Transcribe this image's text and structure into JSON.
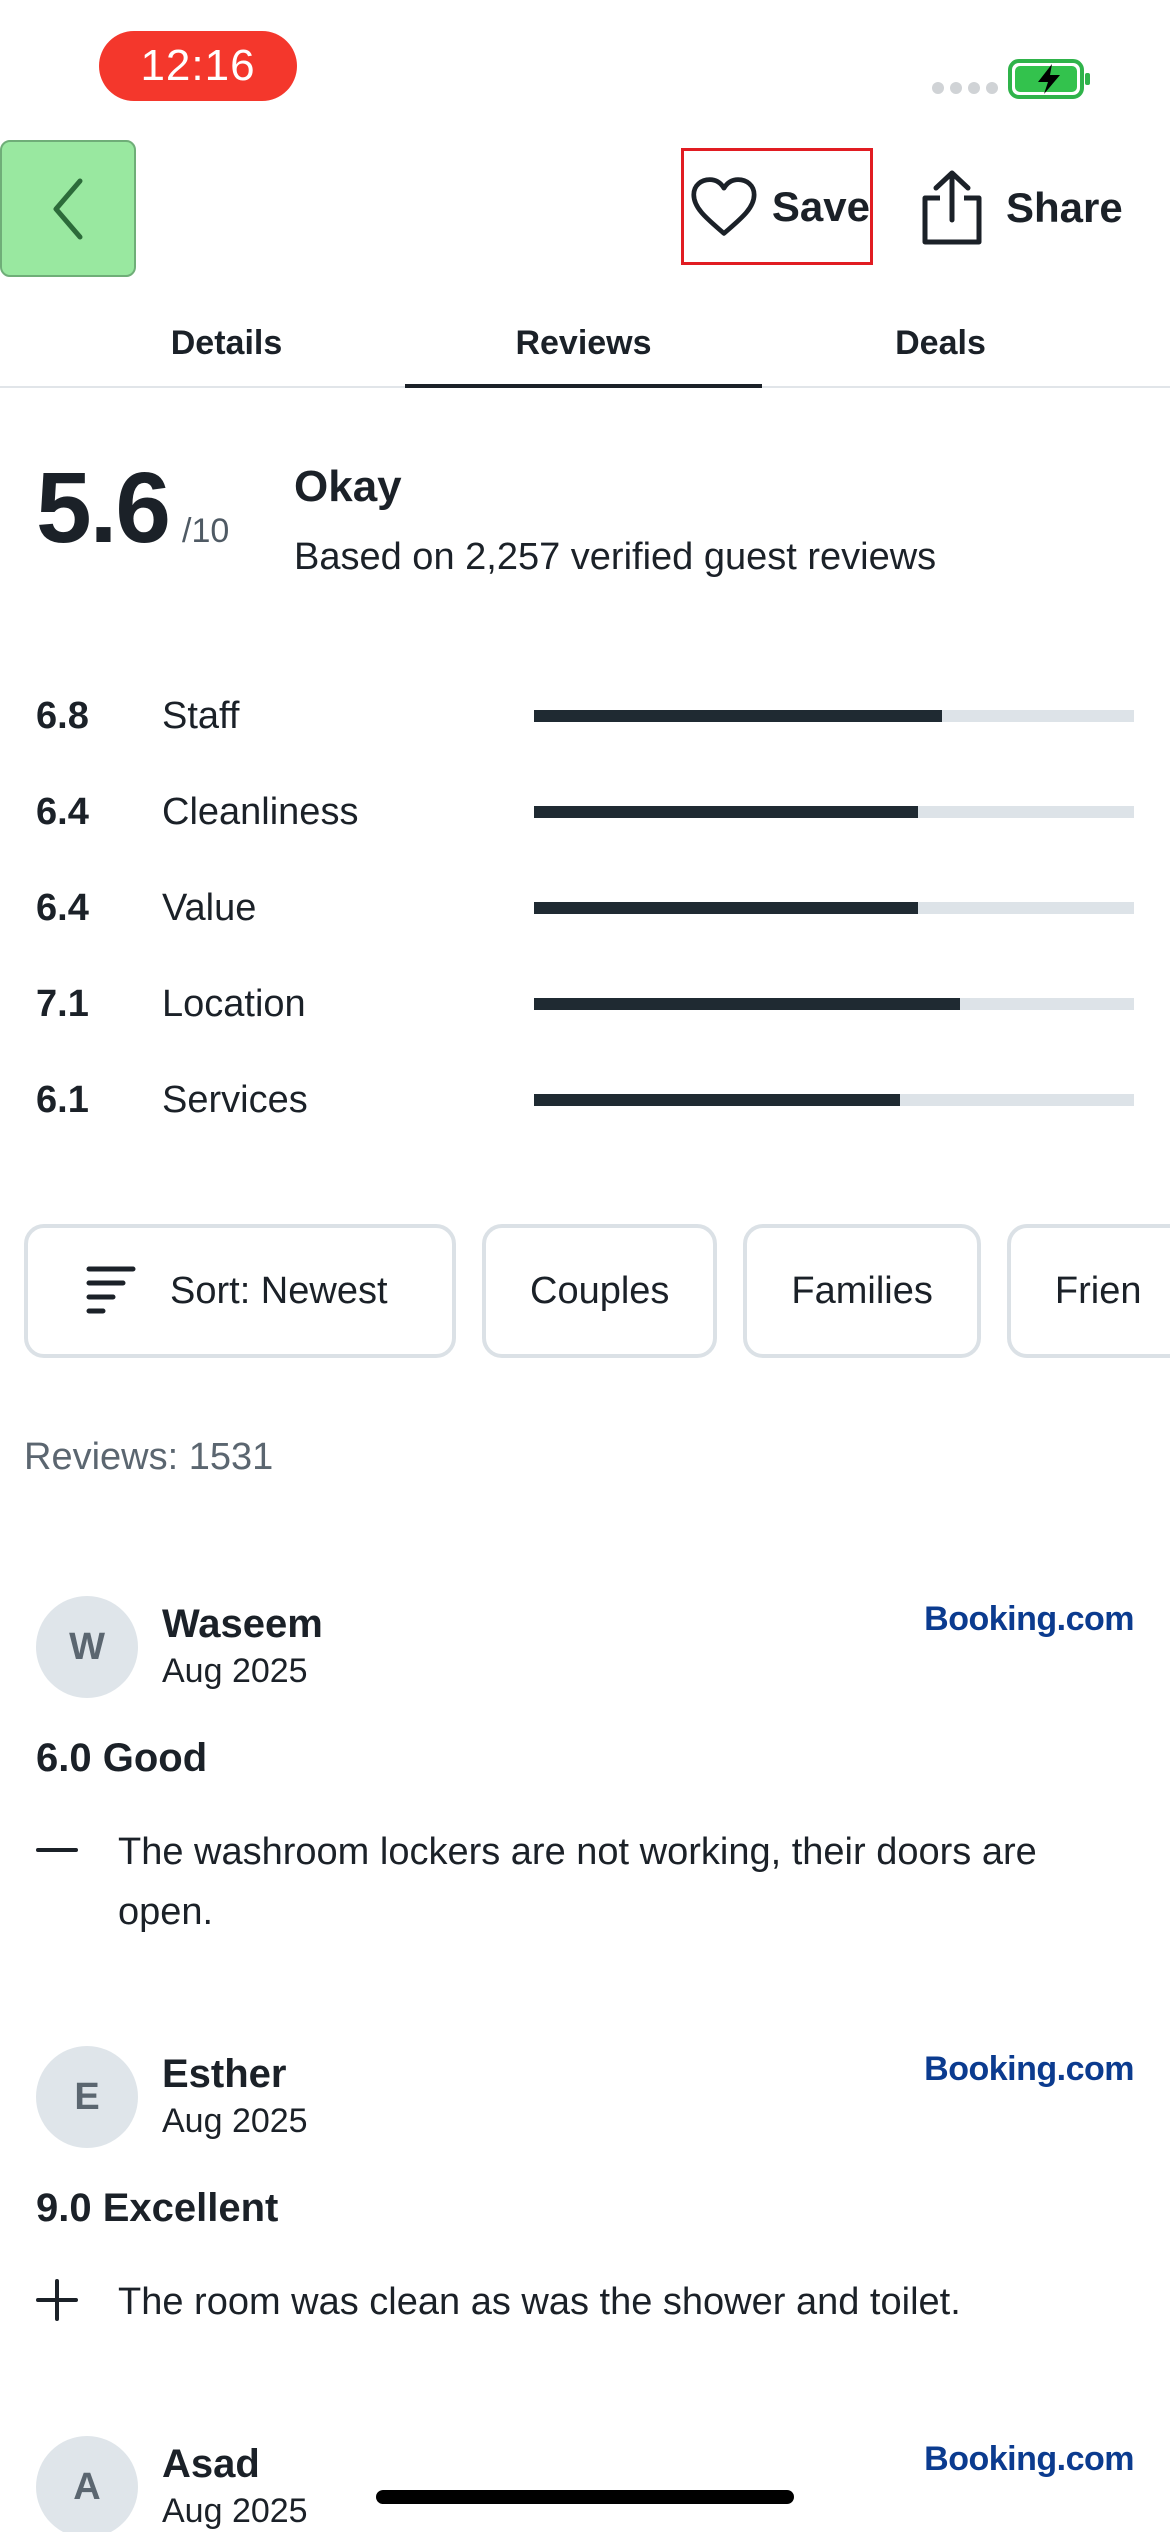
{
  "status_bar": {
    "time": "12:16"
  },
  "header": {
    "back_icon": "chevron-left-icon",
    "save_label": "Save",
    "share_label": "Share"
  },
  "tabs": [
    {
      "label": "Details",
      "active": false
    },
    {
      "label": "Reviews",
      "active": true
    },
    {
      "label": "Deals",
      "active": false
    }
  ],
  "overall": {
    "score": "5.6",
    "out_of": "/10",
    "word": "Okay",
    "basis": "Based on 2,257 verified guest reviews"
  },
  "ratings": [
    {
      "value": "6.8",
      "label": "Staff",
      "fraction": 0.68
    },
    {
      "value": "6.4",
      "label": "Cleanliness",
      "fraction": 0.64
    },
    {
      "value": "6.4",
      "label": "Value",
      "fraction": 0.64
    },
    {
      "value": "7.1",
      "label": "Location",
      "fraction": 0.71
    },
    {
      "value": "6.1",
      "label": "Services",
      "fraction": 0.61
    }
  ],
  "filters": {
    "sort_label": "Sort: Newest",
    "chips": [
      "Couples",
      "Families",
      "Frien"
    ]
  },
  "reviews_count": "Reviews: 1531",
  "reviews": [
    {
      "initial": "W",
      "name": "Waseem",
      "date": "Aug 2025",
      "source": "Booking.com",
      "score": "6.0 Good",
      "sign": "minus",
      "text": "The washroom lockers are not working, their doors are open."
    },
    {
      "initial": "E",
      "name": "Esther",
      "date": "Aug 2025",
      "source": "Booking.com",
      "score": "9.0 Excellent",
      "sign": "plus",
      "text": "The room was clean as was the shower and toilet."
    },
    {
      "initial": "A",
      "name": "Asad",
      "date": "Aug 2025",
      "source": "Booking.com"
    }
  ],
  "colors": {
    "accent_text": "#1b2128",
    "bar_fill": "#1f2a32",
    "bar_track": "#dde3e8",
    "save_outline": "#e11c22",
    "back_button_bg": "#99e8a0",
    "time_pill": "#f4372c",
    "booking_blue": "#0b3b8f"
  }
}
